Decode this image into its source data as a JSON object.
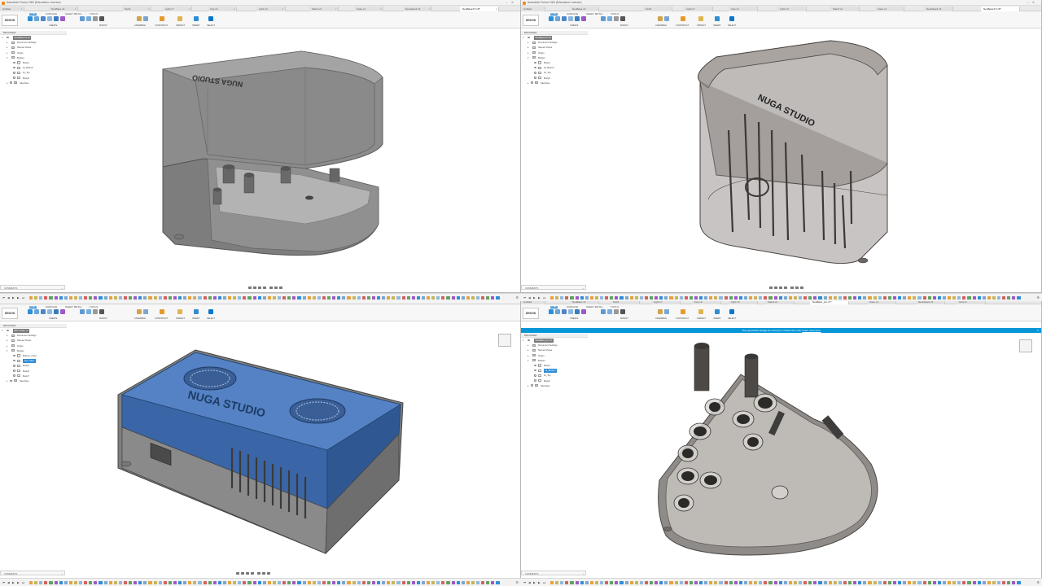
{
  "colors": {
    "accent": "#0a76c9",
    "selection": "#2d8bd6",
    "banner": "#0696d7",
    "model_gray": "#8f8f8f",
    "model_blue": "#3f6fb3"
  },
  "quadrants": [
    {
      "window_title": "Autodesk Fusion 360 (Education License)",
      "tabs": [
        "Untitled",
        "NeoBase v3",
        "Test3",
        "Light-v7",
        "Cap v2",
        "Light v3",
        "Stand v3",
        "Case v1",
        "NeoDase3 v3",
        "Grid v2",
        "NeoBase3.5 v8"
      ],
      "active_tab": "NeoBase3.5 v8*",
      "design_label": "DESIGN",
      "ribbon_tabs": [
        "SOLID",
        "SURFACE",
        "SHEET METAL",
        "TOOLS"
      ],
      "ribbon_groups": [
        "CREATE",
        "MODIFY",
        "ASSEMBLE",
        "CONSTRUCT",
        "INSPECT",
        "INSERT",
        "SELECT"
      ],
      "browser": {
        "header": "BROWSER",
        "rows": [
          "NeoBase3.5 v8",
          "Document Settings",
          "Named Views",
          "Origin",
          "Bodies",
          "Body1",
          "Hi_Bottom",
          "Hi_Top",
          "Body2",
          "Sketches"
        ]
      },
      "comments": "COMMENTS",
      "logo_text": "NUGA STUDIO"
    },
    {
      "window_title": "Autodesk Fusion 360 (Education License)",
      "tabs": [
        "Untitled",
        "NeoBase v3",
        "Test3",
        "Light-v7",
        "Cap v2",
        "Light v3",
        "Stand v3",
        "Case v1",
        "NeoDase3 v3",
        "Grid v2"
      ],
      "active_tab": "NeoBase3.5 v8*",
      "design_label": "DESIGN",
      "ribbon_tabs": [
        "SOLID",
        "SURFACE",
        "SHEET METAL",
        "TOOLS"
      ],
      "ribbon_groups": [
        "CREATE",
        "MODIFY",
        "ASSEMBLE",
        "CONSTRUCT",
        "INSPECT",
        "INSERT",
        "SELECT"
      ],
      "browser": {
        "header": "BROWSER",
        "rows": [
          "NeoBase3.5 v8",
          "Document Settings",
          "Named Views",
          "Origin",
          "Bodies",
          "Body1",
          "Hi_Bottom",
          "Hi_Top",
          "Body2",
          "Sketches"
        ]
      },
      "comments": "COMMENTS",
      "logo_text": "NUGA STUDIO"
    },
    {
      "window_title": "",
      "tabs": [],
      "active_tab": "RKG Case v3*",
      "design_label": "DESIGN",
      "ribbon_tabs": [
        "SOLID",
        "SURFACE",
        "SHEET METAL",
        "TOOLS"
      ],
      "ribbon_groups": [
        "CREATE",
        "MODIFY",
        "ASSEMBLE",
        "CONSTRUCT",
        "INSPECT",
        "INSERT",
        "SELECT"
      ],
      "browser": {
        "header": "BROWSER",
        "rows": [
          "RKG Case v3",
          "Document Settings",
          "Named Views",
          "Origin",
          "Bodies",
          "Bottom_Case",
          "Top_Case",
          "Body3",
          "Body6",
          "Body7",
          "Sketches"
        ]
      },
      "comments": "COMMENTS",
      "logo_text": "NUGA STUDIO"
    },
    {
      "window_title": "Autodesk Fusion 360 (Education License)",
      "tabs": [
        "Untitled",
        "NeoBase v3",
        "Test3",
        "Light-v7",
        "Cap v2",
        "Light v3",
        "Stand v3",
        "Case v1",
        "NeoDase3 v3",
        "Grid v2"
      ],
      "active_tab": "NeoBase_pro v7*",
      "design_label": "DESIGN",
      "ribbon_tabs": [
        "SOLID",
        "SURFACE",
        "SHEET METAL",
        "TOOLS"
      ],
      "ribbon_groups": [
        "CREATE",
        "MODIFY",
        "ASSEMBLE",
        "CONSTRUCT",
        "INSPECT",
        "INSERT",
        "SELECT"
      ],
      "banner_text": "Free generative design for everyone. Limited time only.",
      "banner_link": "Learn more here.",
      "browser": {
        "header": "BROWSER",
        "rows": [
          "NeoBase_pro v7",
          "Document Settings",
          "Named Views",
          "Origin",
          "Bodies",
          "Body1",
          "Hi_Bottom",
          "Hi_Top",
          "Body2",
          "Sketches"
        ]
      },
      "comments": "COMMENTS"
    }
  ]
}
